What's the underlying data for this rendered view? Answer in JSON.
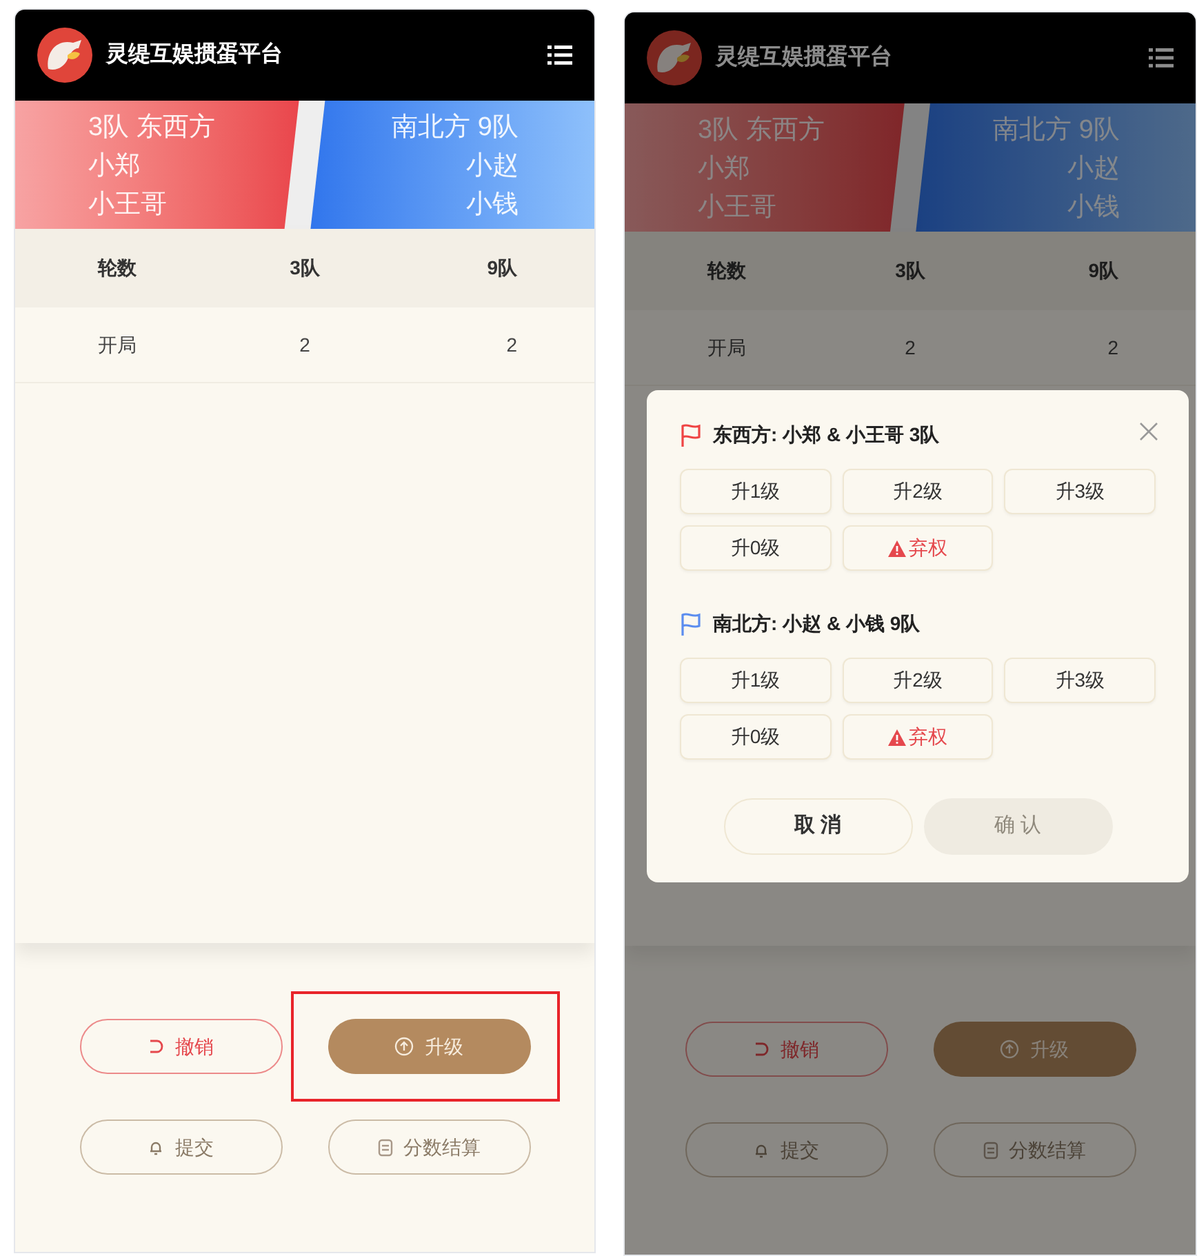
{
  "screens": [
    {
      "header": {
        "title": "灵缇互娱掼蛋平台"
      },
      "teams": [
        {
          "kind": "left",
          "line1": "3队 东西方",
          "players": [
            "小郑",
            "小王哥"
          ]
        },
        {
          "kind": "right",
          "line1": "南北方 9队",
          "players": [
            "小赵",
            "小钱"
          ]
        }
      ],
      "table": {
        "columns": [
          "轮数",
          "3队",
          "9队"
        ],
        "rows": [
          [
            "开局",
            "2",
            "2"
          ]
        ]
      },
      "actions": [
        {
          "label": "撤销",
          "kind": "undo",
          "highlighted": false
        },
        {
          "label": "升级",
          "kind": "upgrade",
          "highlighted": true
        },
        {
          "label": "提交",
          "kind": "submit",
          "highlighted": false
        },
        {
          "label": "分数结算",
          "kind": "settle",
          "highlighted": false
        }
      ]
    },
    {
      "header": {
        "title": "灵缇互娱掼蛋平台"
      },
      "teams": [
        {
          "kind": "left",
          "line1": "3队 东西方",
          "players": [
            "小郑",
            "小王哥"
          ]
        },
        {
          "kind": "right",
          "line1": "南北方 9队",
          "players": [
            "小赵",
            "小钱"
          ]
        }
      ],
      "table": {
        "columns": [
          "轮数",
          "3队",
          "9队"
        ],
        "rows": [
          [
            "开局",
            "2",
            "2"
          ]
        ]
      },
      "actions": [
        {
          "label": "撤销",
          "kind": "undo",
          "highlighted": false
        },
        {
          "label": "升级",
          "kind": "upgrade",
          "highlighted": false
        },
        {
          "label": "提交",
          "kind": "submit",
          "highlighted": false
        },
        {
          "label": "分数结算",
          "kind": "settle",
          "highlighted": false
        }
      ],
      "dialog": {
        "groups": [
          {
            "title": "东西方: 小郑 & 小王哥 3队",
            "color": "#ef4444",
            "options": [
              {
                "label": "升1级",
                "kind": "level"
              },
              {
                "label": "升2级",
                "kind": "level"
              },
              {
                "label": "升3级",
                "kind": "level"
              },
              {
                "label": "升0级",
                "kind": "level"
              },
              {
                "label": "弃权",
                "kind": "forfeit"
              }
            ]
          },
          {
            "title": "南北方: 小赵 & 小钱 9队",
            "color": "#5b8def",
            "options": [
              {
                "label": "升1级",
                "kind": "level"
              },
              {
                "label": "升2级",
                "kind": "level"
              },
              {
                "label": "升3级",
                "kind": "level"
              },
              {
                "label": "升0级",
                "kind": "level"
              },
              {
                "label": "弃权",
                "kind": "forfeit"
              }
            ]
          }
        ],
        "buttons": [
          {
            "label": "取 消",
            "disabled": false
          },
          {
            "label": "确 认",
            "disabled": true
          }
        ]
      }
    }
  ]
}
